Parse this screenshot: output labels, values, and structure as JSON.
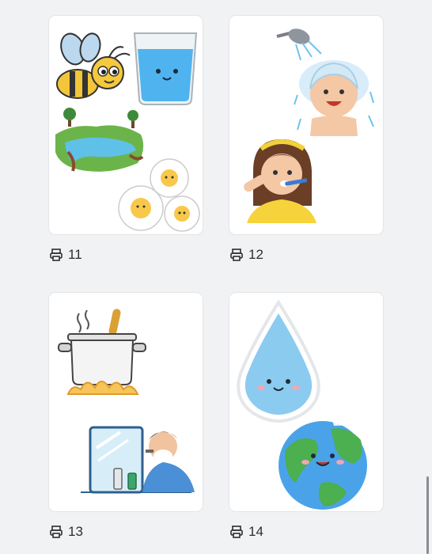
{
  "pages": [
    {
      "count": "11",
      "icon": "printer-icon",
      "images": [
        "bee-cartoon",
        "water-glass-cartoon",
        "river-landscape",
        "daisy-flowers"
      ]
    },
    {
      "count": "12",
      "icon": "printer-icon",
      "images": [
        "child-showering",
        "girl-brushing-teeth"
      ]
    },
    {
      "count": "13",
      "icon": "printer-icon",
      "images": [
        "boiling-pot-on-fire",
        "man-shaving-at-mirror"
      ]
    },
    {
      "count": "14",
      "icon": "printer-icon",
      "images": [
        "water-drop-character",
        "earth-globe-character"
      ]
    }
  ],
  "colors": {
    "background": "#f1f2f4",
    "card": "#ffffff",
    "text": "#2b2d31"
  }
}
